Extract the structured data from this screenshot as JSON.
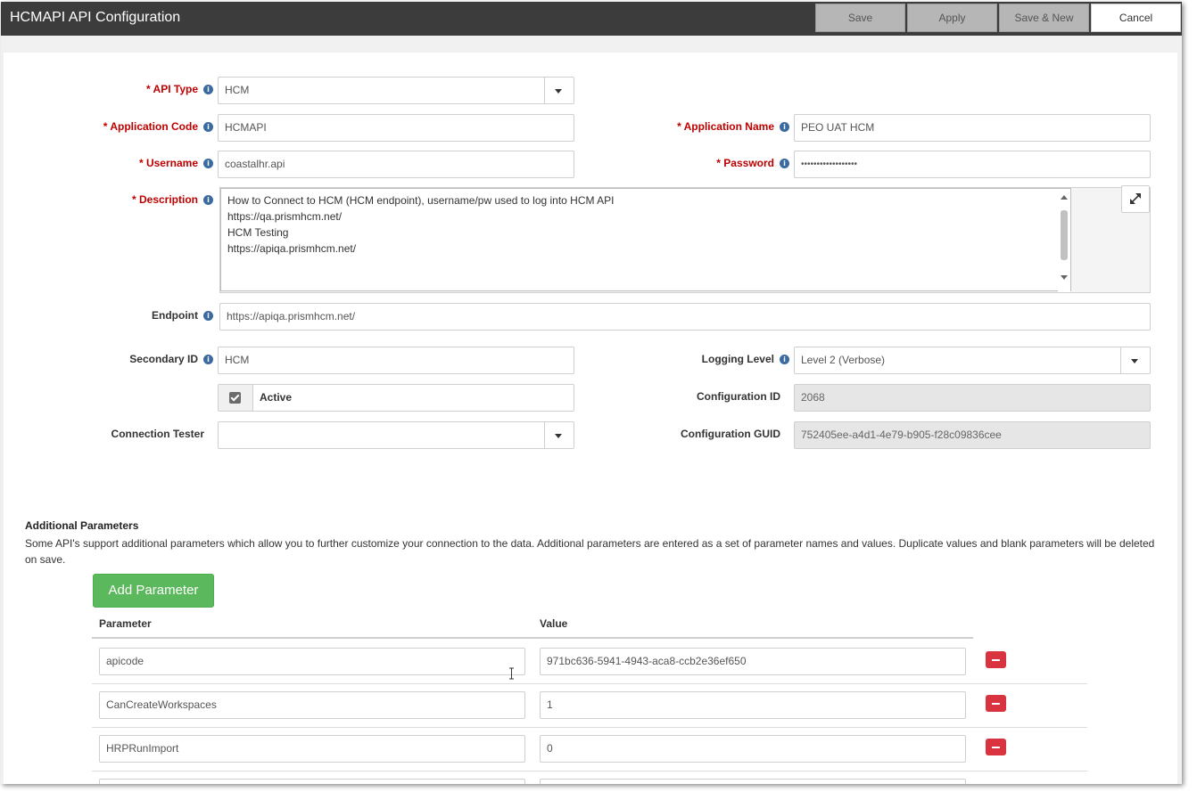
{
  "window": {
    "title": "HCMAPI API Configuration",
    "buttons": {
      "save": "Save",
      "apply": "Apply",
      "save_new": "Save & New",
      "cancel": "Cancel"
    }
  },
  "form": {
    "api_type": {
      "label": "* API Type",
      "value": "HCM"
    },
    "application_code": {
      "label": "* Application Code",
      "value": "HCMAPI"
    },
    "application_name": {
      "label": "* Application Name",
      "value": "PEO UAT HCM"
    },
    "username": {
      "label": "* Username",
      "value": "coastalhr.api"
    },
    "password": {
      "label": "* Password",
      "value": "••••••••••••••••••"
    },
    "description": {
      "label": "* Description",
      "lines": [
        "How to Connect to HCM (HCM endpoint), username/pw used to log into HCM API",
        "https://qa.prismhcm.net/",
        "HCM Testing",
        "https://apiqa.prismhcm.net/"
      ]
    },
    "endpoint": {
      "label": "Endpoint",
      "value": "https://apiqa.prismhcm.net/"
    },
    "secondary_id": {
      "label": "Secondary ID",
      "value": "HCM"
    },
    "logging_level": {
      "label": "Logging Level",
      "value": "Level 2 (Verbose)"
    },
    "active": {
      "label": "Active",
      "checked": true
    },
    "configuration_id": {
      "label": "Configuration ID",
      "value": "2068"
    },
    "connection_tester": {
      "label": "Connection Tester",
      "value": ""
    },
    "configuration_guid": {
      "label": "Configuration GUID",
      "value": "752405ee-a4d1-4e79-b905-f28c09836cee"
    }
  },
  "additional": {
    "title": "Additional Parameters",
    "description": "Some API's support additional parameters which allow you to further customize your connection to the data. Additional parameters are entered as a set of parameter names and values. Duplicate values and blank parameters will be deleted on save.",
    "add_button": "Add Parameter",
    "col_parameter": "Parameter",
    "col_value": "Value",
    "rows": [
      {
        "parameter": "apicode",
        "value": "971bc636-5941-4943-aca8-ccb2e36ef650"
      },
      {
        "parameter": "CanCreateWorkspaces",
        "value": "1"
      },
      {
        "parameter": "HRPRunImport",
        "value": "0"
      }
    ]
  },
  "colors": {
    "required": "#c00000",
    "add_button": "#5cb85c",
    "remove_button": "#d9333f",
    "titlebar": "#3c3c3c"
  },
  "icons": [
    "info-icon",
    "caret-down-icon",
    "expand-icon",
    "checkmark-icon",
    "minus-icon",
    "text-cursor-icon"
  ]
}
